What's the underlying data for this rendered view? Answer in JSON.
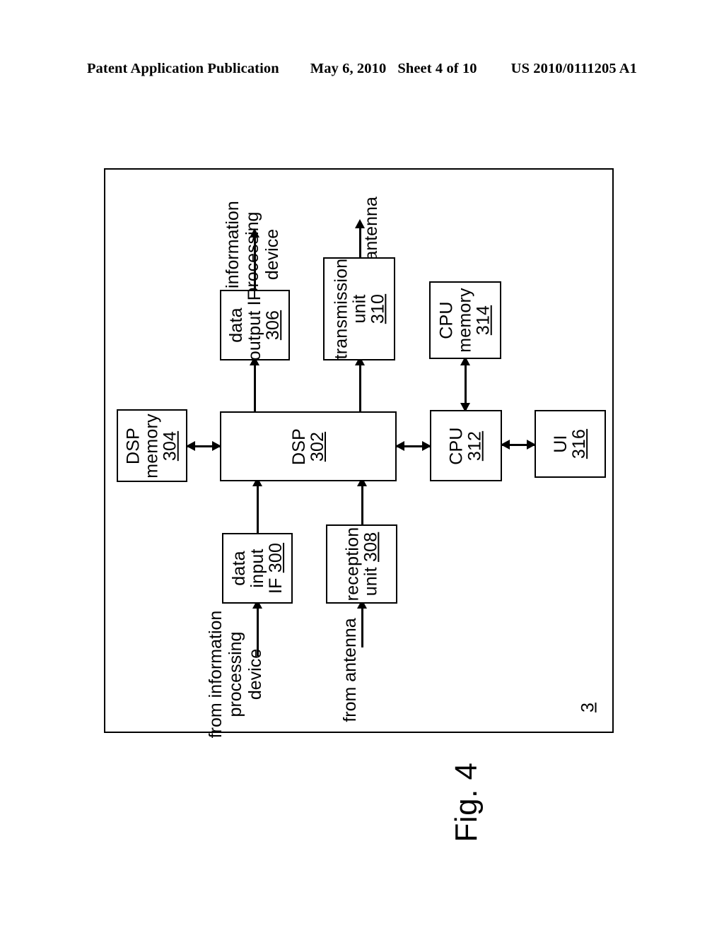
{
  "header": {
    "publication": "Patent Application Publication",
    "date": "May 6, 2010",
    "sheet": "Sheet 4 of 10",
    "patent_number": "US 2010/0111205 A1"
  },
  "figure": {
    "caption": "Fig. 4",
    "reference_numeral": "3",
    "orientation": "rotated-90-ccw"
  },
  "blocks": [
    {
      "id": "data-output-if",
      "lines": [
        "data",
        "output IF"
      ],
      "number": "306"
    },
    {
      "id": "transmission-unit",
      "lines": [
        "transmission",
        "unit"
      ],
      "number": "310"
    },
    {
      "id": "cpu-memory",
      "lines": [
        "CPU",
        "memory"
      ],
      "number": "314"
    },
    {
      "id": "dsp-memory",
      "lines": [
        "DSP",
        "memory"
      ],
      "number": "304"
    },
    {
      "id": "dsp",
      "lines": [
        "DSP"
      ],
      "number": "302"
    },
    {
      "id": "cpu",
      "lines": [
        "CPU"
      ],
      "number": "312"
    },
    {
      "id": "ui",
      "lines": [
        "UI"
      ],
      "number": "316"
    },
    {
      "id": "data-input-if",
      "lines": [
        "data",
        "input",
        "IF"
      ],
      "number": "300"
    },
    {
      "id": "reception-unit",
      "lines": [
        "reception",
        "unit"
      ],
      "number": "308"
    }
  ],
  "block_text": {
    "data_output_if_l1": "data",
    "data_output_if_l2": "output IF",
    "data_output_if_num": "306",
    "transmission_l1": "transmission",
    "transmission_l2": "unit",
    "transmission_num": "310",
    "cpu_memory_l1": "CPU",
    "cpu_memory_l2": "memory",
    "cpu_memory_num": "314",
    "dsp_memory_l1": "DSP",
    "dsp_memory_l2": "memory",
    "dsp_memory_num": "304",
    "dsp_l1": "DSP",
    "dsp_num": "302",
    "cpu_l1": "CPU",
    "cpu_num": "312",
    "ui_l1": "UI",
    "ui_num": "316",
    "data_input_if_l1": "data",
    "data_input_if_l2": "input",
    "data_input_if_l3": "IF",
    "data_input_if_num": "300",
    "reception_l1": "reception",
    "reception_l2": "unit",
    "reception_num": "308"
  },
  "captions": {
    "to_information_l1": "to information",
    "to_information_l2": "processing",
    "to_information_l3": "device",
    "to_antenna": "TO antenna",
    "from_information_l1": "from information",
    "from_information_l2": "processing",
    "from_information_l3": "device",
    "from_antenna": "from antenna"
  },
  "connections": [
    {
      "from": "dsp",
      "to": "data-output-if",
      "type": "arrow"
    },
    {
      "from": "data-output-if",
      "to": "to-information-processing-device",
      "type": "arrow"
    },
    {
      "from": "dsp",
      "to": "transmission-unit",
      "type": "arrow"
    },
    {
      "from": "transmission-unit",
      "to": "to-antenna",
      "type": "arrow"
    },
    {
      "from": "dsp-memory",
      "to": "dsp",
      "type": "double-arrow"
    },
    {
      "from": "dsp",
      "to": "cpu",
      "type": "double-arrow"
    },
    {
      "from": "cpu",
      "to": "cpu-memory",
      "type": "double-arrow"
    },
    {
      "from": "cpu",
      "to": "ui",
      "type": "double-arrow"
    },
    {
      "from": "data-input-if",
      "to": "dsp",
      "type": "arrow"
    },
    {
      "from": "from-information-processing-device",
      "to": "data-input-if",
      "type": "arrow"
    },
    {
      "from": "reception-unit",
      "to": "dsp",
      "type": "arrow"
    },
    {
      "from": "from-antenna",
      "to": "reception-unit",
      "type": "arrow"
    }
  ],
  "colors": {
    "ink": "#000000",
    "paper": "#ffffff"
  }
}
